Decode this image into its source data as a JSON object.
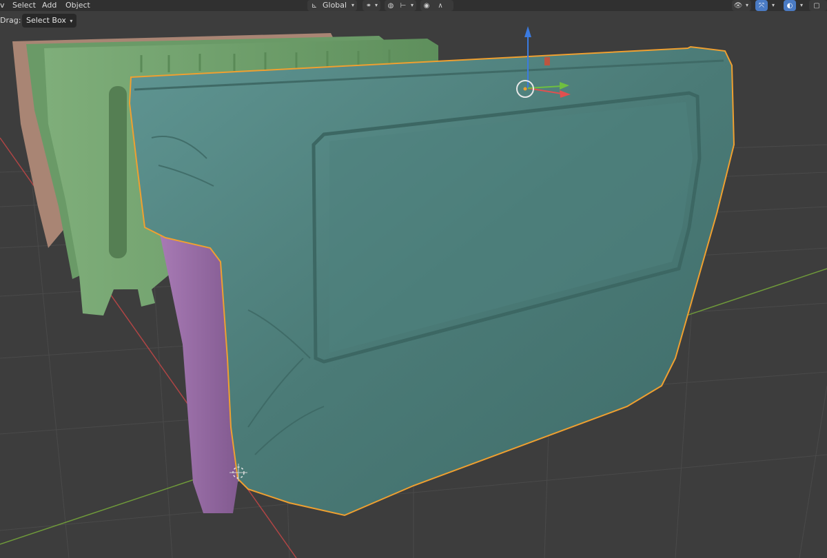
{
  "header": {
    "menu": [
      "Select",
      "Add",
      "Object"
    ],
    "left_cut_char": "v",
    "orientation_label": "Global"
  },
  "toolbar": {
    "drag_label": "Drag:",
    "select_box_label": "Select Box"
  },
  "colors": {
    "viewport_bg": "#3d3d3d",
    "grid_line": "#4a4a4a",
    "axis_x": "#b04545",
    "axis_y": "#6f9a3a",
    "teal_mesh": "#4d7f7a",
    "green_mesh": "#6f9e6c",
    "pink_mesh": "#a98574",
    "purple_mesh": "#9a6aa7",
    "selection_outline": "#f0a030",
    "gizmo_z": "#3b7be0",
    "gizmo_x": "#e05050",
    "gizmo_y": "#6fbf40"
  },
  "icons": {
    "transform_orientation": "transform-orientation-icon",
    "pivot": "pivot-icon",
    "snap": "snap-icon",
    "proportional": "proportional-edit-icon",
    "falloff": "falloff-icon",
    "visibility": "visibility-icon",
    "gizmo": "gizmo-icon",
    "overlays": "overlays-icon"
  }
}
